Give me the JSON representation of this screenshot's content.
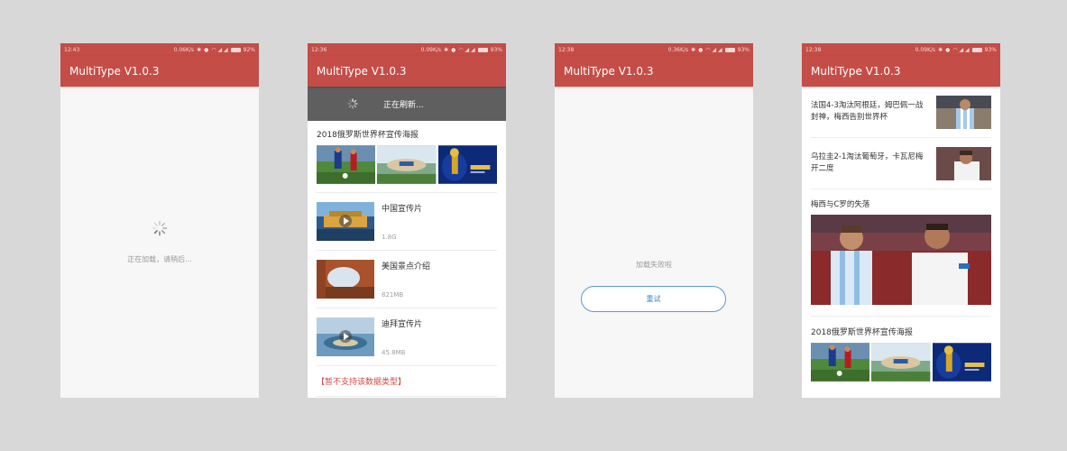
{
  "colors": {
    "primary": "#c44d47",
    "refresh_bar": "#5f5f5f",
    "error_red": "#d04a45",
    "retry_blue": "#5b9bd5"
  },
  "screens": {
    "loading": {
      "status": {
        "time": "12:43",
        "speed": "0.06K/s",
        "battery": "92%"
      },
      "title": "MultiType V1.0.3",
      "loading_text": "正在加载，请稍后..."
    },
    "refresh": {
      "status": {
        "time": "12:36",
        "speed": "0.09K/s",
        "battery": "93%"
      },
      "title": "MultiType V1.0.3",
      "refresh_text": "正在刷新...",
      "poster_title": "2018俄罗斯世界杯宣传海报",
      "videos": [
        {
          "title": "中国宣传片",
          "size": "1.8G"
        },
        {
          "title": "美国景点介绍",
          "size": "821MB"
        },
        {
          "title": "迪拜宣传片",
          "size": "45.8MB"
        }
      ],
      "unsupported_text": "【暂不支持该数据类型】"
    },
    "error": {
      "status": {
        "time": "12:38",
        "speed": "0.36K/s",
        "battery": "93%"
      },
      "title": "MultiType V1.0.3",
      "error_text": "加载失败啦",
      "retry_label": "重试"
    },
    "news": {
      "status": {
        "time": "12:38",
        "speed": "0.09K/s",
        "battery": "93%"
      },
      "title": "MultiType V1.0.3",
      "items": [
        {
          "title": "法国4-3淘汰阿根廷，姆巴佩一战封神，梅西告别世界杯"
        },
        {
          "title": "乌拉圭2-1淘汰葡萄牙，卡瓦尼梅开二度"
        }
      ],
      "big_title": "梅西与C罗的失落",
      "poster_title": "2018俄罗斯世界杯宣传海报"
    }
  }
}
